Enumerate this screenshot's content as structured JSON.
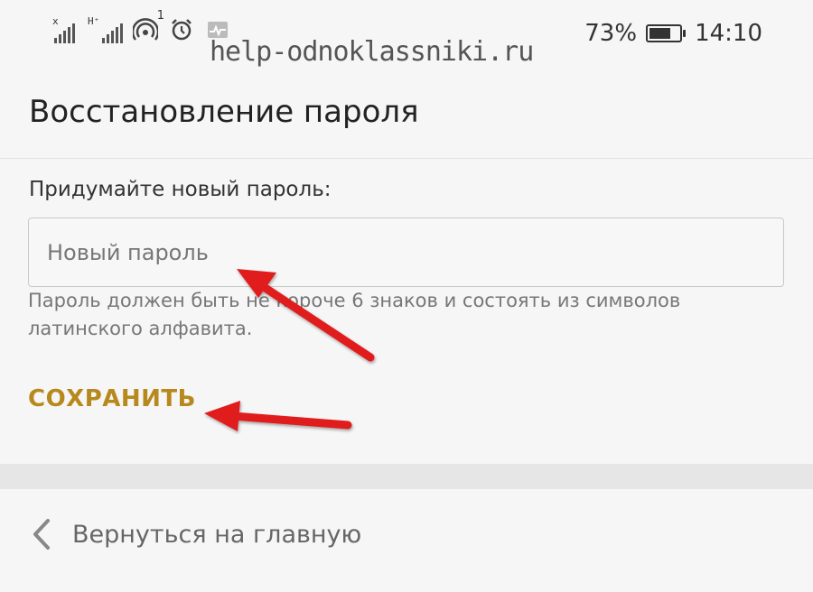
{
  "status_bar": {
    "signal1_label": "x",
    "signal2_label": "H⁺",
    "notif_count": "1",
    "battery_text": "73%",
    "battery_level": 0.73,
    "time": "14:10"
  },
  "watermark": "help-odnoklassniki.ru",
  "page": {
    "title": "Восстановление пароля",
    "prompt": "Придумайте новый пароль:",
    "password_placeholder": "Новый пароль",
    "password_value": "",
    "hint": "Пароль должен быть не короче 6 знаков и состоять из символов латинского алфавита.",
    "save_label": "СОХРАНИТЬ",
    "back_label": "Вернуться на главную"
  },
  "colors": {
    "accent": "#b7891c",
    "annotation_arrow": "#e01f1f"
  },
  "icons": {
    "signal1": "signal-icon",
    "signal2": "signal-icon",
    "hotspot": "hotspot-icon",
    "alarm": "alarm-clock-icon",
    "activity": "activity-icon",
    "battery": "battery-icon",
    "back": "chevron-left-icon"
  }
}
